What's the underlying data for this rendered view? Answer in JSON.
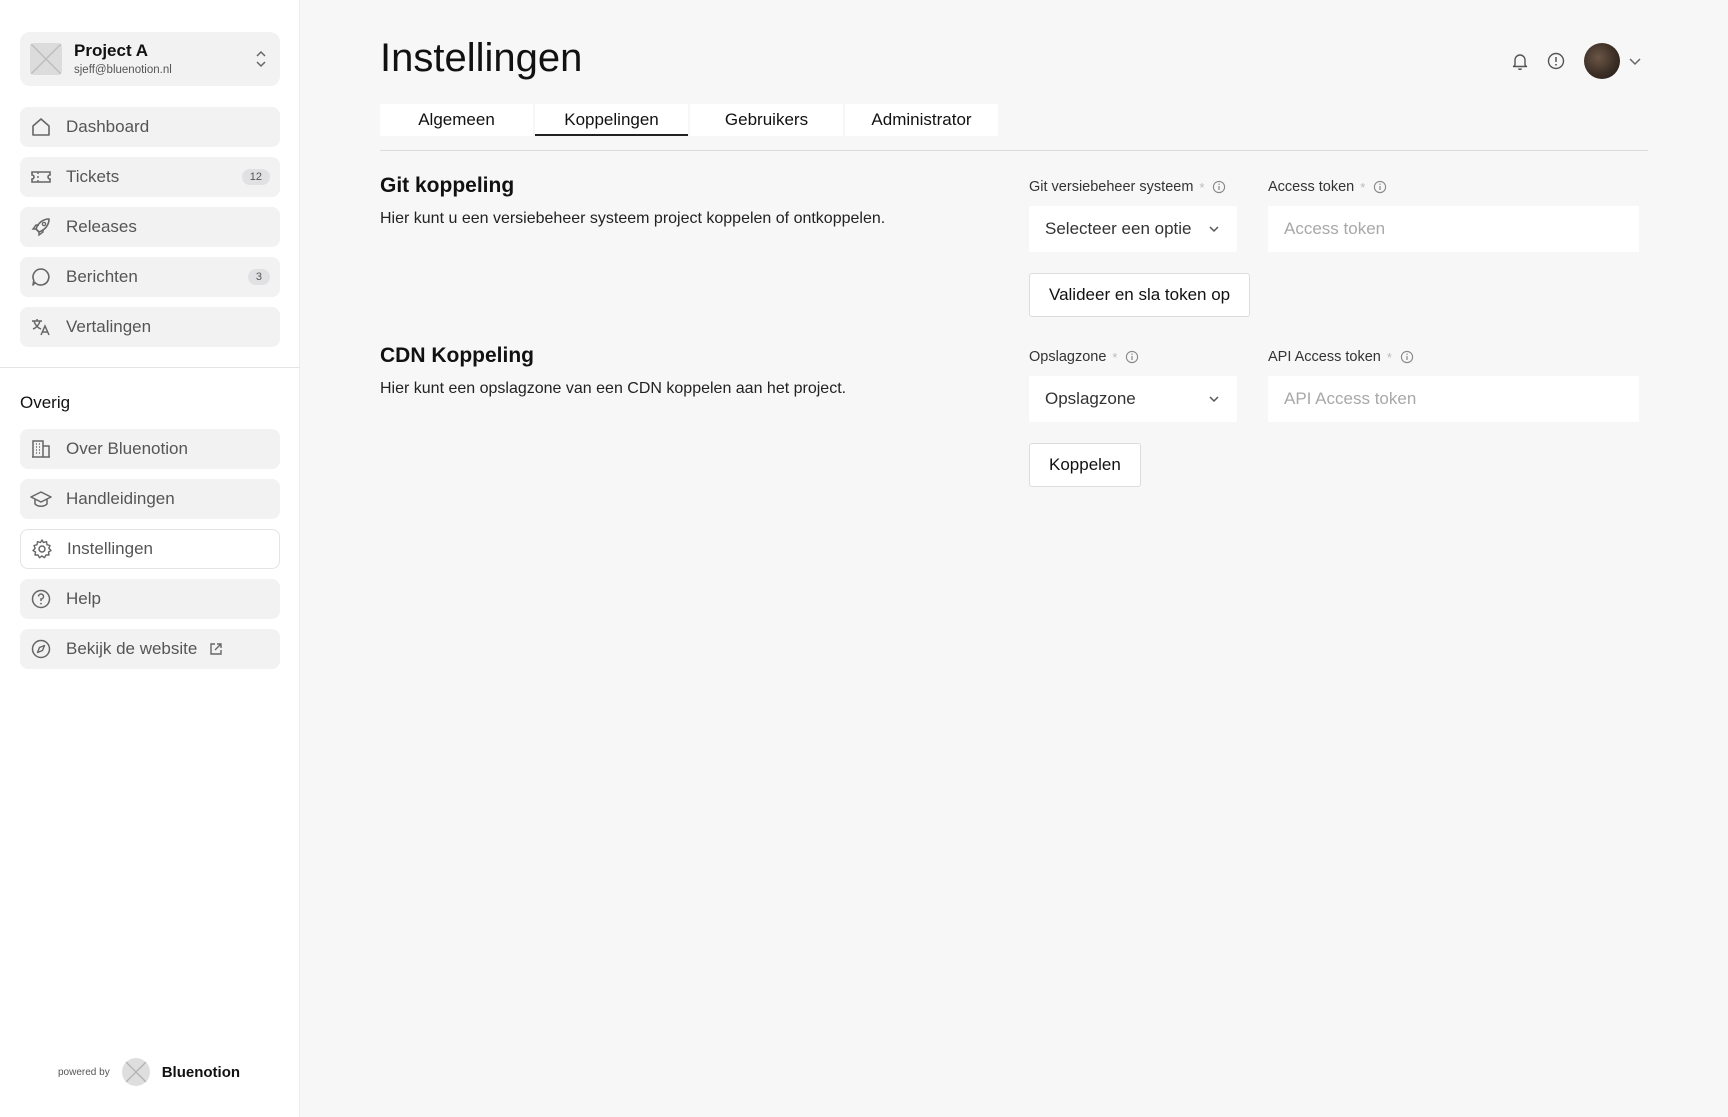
{
  "project": {
    "name": "Project A",
    "email": "sjeff@bluenotion.nl"
  },
  "nav": {
    "items": [
      {
        "label": "Dashboard",
        "icon": "home-icon"
      },
      {
        "label": "Tickets",
        "icon": "ticket-icon",
        "badge": "12"
      },
      {
        "label": "Releases",
        "icon": "rocket-icon"
      },
      {
        "label": "Berichten",
        "icon": "chat-icon",
        "badge": "3"
      },
      {
        "label": "Vertalingen",
        "icon": "translate-icon"
      }
    ],
    "section_title": "Overig",
    "other_items": [
      {
        "label": "Over Bluenotion",
        "icon": "building-icon"
      },
      {
        "label": "Handleidingen",
        "icon": "graduation-cap-icon"
      },
      {
        "label": "Instellingen",
        "icon": "gear-icon",
        "active": true
      },
      {
        "label": "Help",
        "icon": "help-circle-icon"
      },
      {
        "label": "Bekijk de website",
        "icon": "compass-icon",
        "external": true
      }
    ]
  },
  "footer": {
    "powered_by": "powered by",
    "brand": "Bluenotion"
  },
  "header": {
    "title": "Instellingen",
    "icons": [
      "bell-icon",
      "info-icon",
      "avatar",
      "chevron-down-icon"
    ]
  },
  "tabs": [
    {
      "label": "Algemeen",
      "active": false
    },
    {
      "label": "Koppelingen",
      "active": true
    },
    {
      "label": "Gebruikers",
      "active": false
    },
    {
      "label": "Administrator",
      "active": false
    }
  ],
  "git": {
    "title": "Git koppeling",
    "description": "Hier kunt u een versiebeheer systeem project koppelen of ontkoppelen.",
    "vcs_label": "Git versiebeheer systeem",
    "vcs_value": "Selecteer een optie",
    "token_label": "Access token",
    "token_placeholder": "Access token",
    "button": "Valideer en sla token op"
  },
  "cdn": {
    "title": "CDN Koppeling",
    "description": "Hier kunt een opslagzone van een CDN koppelen aan het project.",
    "zone_label": "Opslagzone",
    "zone_value": "Opslagzone",
    "token_label": "API Access token",
    "token_placeholder": "API Access token",
    "button": "Koppelen"
  },
  "required_mark": "*",
  "colors": {
    "background": "#f7f7f8",
    "sidebar": "#ffffff",
    "nav_item": "#f2f2f3",
    "text": "#111111",
    "muted": "#555555"
  }
}
